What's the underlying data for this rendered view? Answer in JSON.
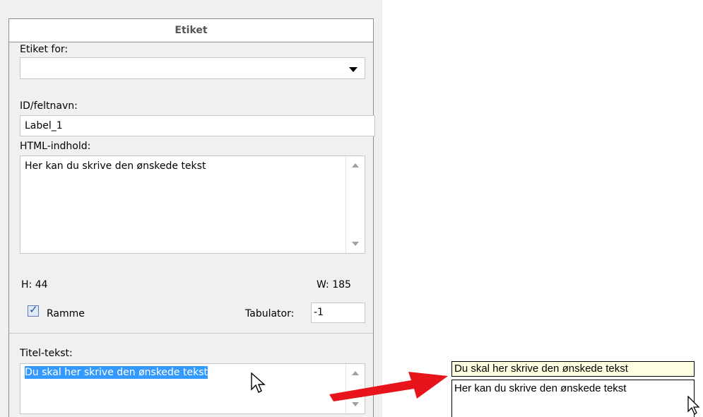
{
  "panel": {
    "title": "Etiket",
    "label_for": {
      "label": "Etiket for:",
      "value": ""
    },
    "id_field": {
      "label": "ID/feltnavn:",
      "value": "Label_1"
    },
    "html_content": {
      "label": "HTML-indhold:",
      "value": "Her kan du skrive den ønskede tekst"
    },
    "height": "H: 44",
    "width": "W: 185",
    "frame_checkbox": {
      "label": "Ramme",
      "checked": true
    },
    "tab_index": {
      "label": "Tabulator:",
      "value": "-1"
    },
    "title_text": {
      "label": "Titel-tekst:",
      "value": "Du skal her skrive den ønskede tekst"
    }
  },
  "preview": {
    "tooltip": "Du skal her skrive den ønskede tekst",
    "label_text": "Her kan du skrive den ønskede tekst"
  },
  "colors": {
    "arrow": "#e8141c",
    "selection": "#3399ff",
    "tooltip_bg": "#ffffe1"
  }
}
